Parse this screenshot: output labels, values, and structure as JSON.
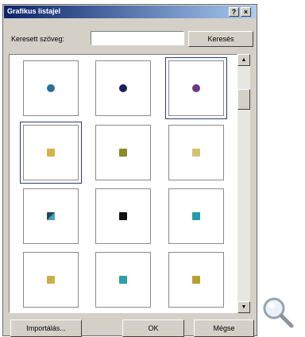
{
  "dialog": {
    "title": "Grafikus listajel",
    "help_label": "?",
    "close_label": "×"
  },
  "search": {
    "label": "Keresett szöveg:",
    "value": "",
    "button_label": "Keresés"
  },
  "scrollbar": {
    "up_glyph": "▲",
    "down_glyph": "▼"
  },
  "bullets": [
    {
      "shape": "circle",
      "color": "#2a6f97",
      "selected": false
    },
    {
      "shape": "circle",
      "color": "#1f1f5c",
      "selected": false
    },
    {
      "shape": "circle",
      "color": "#6a3a7a",
      "selected": true
    },
    {
      "shape": "square",
      "color": "#d6b24a",
      "selected": true
    },
    {
      "shape": "square",
      "color": "#8c8a2a",
      "selected": false
    },
    {
      "shape": "square",
      "color": "#d6c070",
      "selected": false
    },
    {
      "shape": "square-split",
      "color": "#1a4a5a",
      "selected": false
    },
    {
      "shape": "square",
      "color": "#111111",
      "selected": false
    },
    {
      "shape": "square",
      "color": "#2a9aa8",
      "selected": false
    },
    {
      "shape": "square",
      "color": "#c9b04a",
      "selected": false
    },
    {
      "shape": "square",
      "color": "#2aa0a8",
      "selected": false
    },
    {
      "shape": "square",
      "color": "#b8a030",
      "selected": false
    }
  ],
  "footer": {
    "import_label": "Importálás...",
    "ok_label": "OK",
    "cancel_label": "Mégse"
  },
  "icons": {
    "zoom": "magnifier-icon"
  }
}
